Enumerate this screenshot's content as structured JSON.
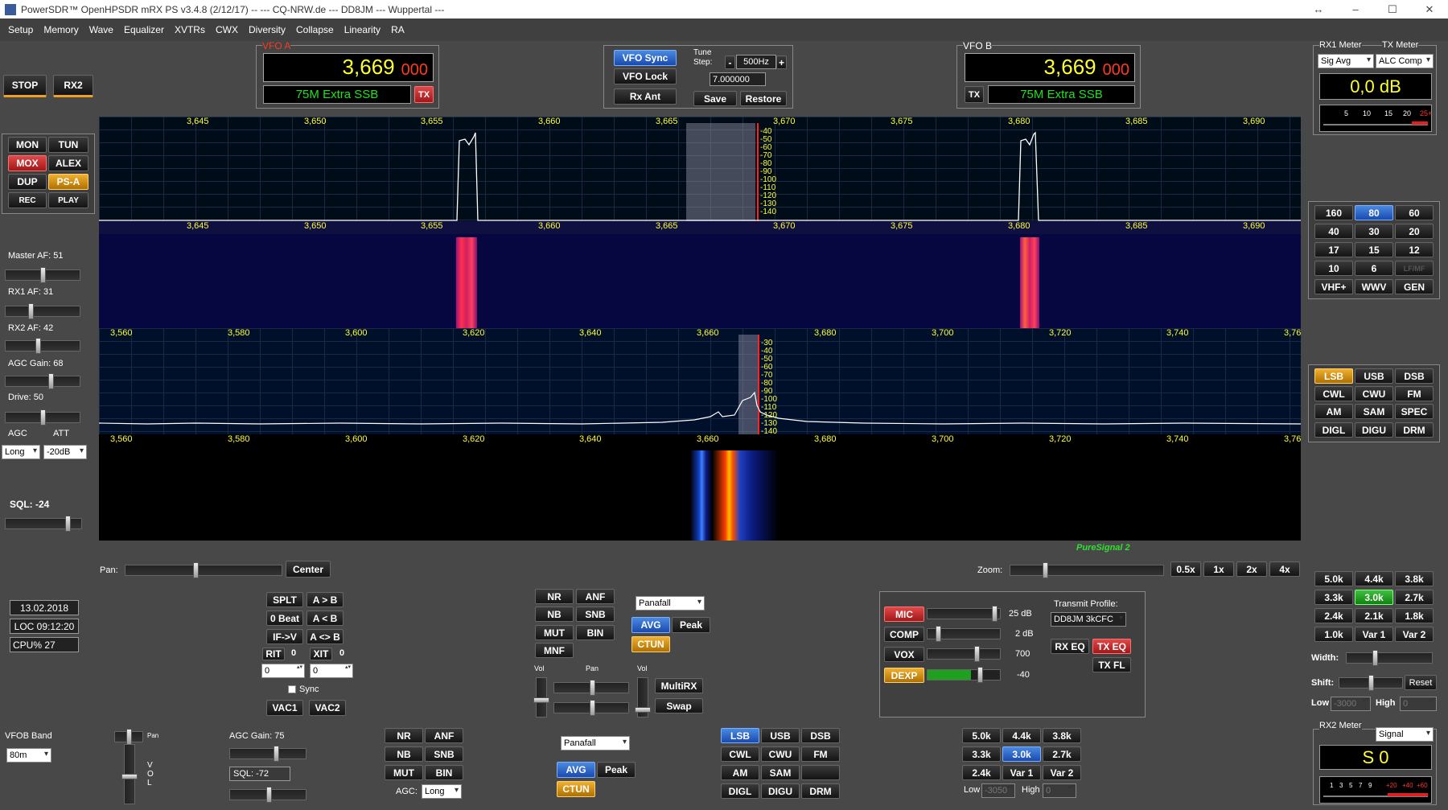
{
  "title": "PowerSDR™ OpenHPSDR mRX PS v3.4.8 (2/12/17)  --  ---  CQ-NRW.de  ---  DD8JM  ---  Wuppertal  ---",
  "menu": [
    "Setup",
    "Memory",
    "Wave",
    "Equalizer",
    "XVTRs",
    "CWX",
    "Diversity",
    "Collapse",
    "Linearity",
    "RA"
  ],
  "left": {
    "stop": "STOP",
    "rx2": "RX2",
    "mon": "MON",
    "tun": "TUN",
    "mox": "MOX",
    "alex": "ALEX",
    "dup": "DUP",
    "psa": "PS-A",
    "rec": "REC",
    "play": "PLAY",
    "master_af": "Master AF:  51",
    "rx1_af": "RX1 AF:  31",
    "rx2_af": "RX2 AF:  42",
    "agc_gain": "AGC Gain:  68",
    "drive": "Drive:  50",
    "agc": "AGC",
    "att": "ATT",
    "agc_val": "Long",
    "att_val": "-20dB",
    "sql": "SQL:  -24"
  },
  "vfoa": {
    "label": "VFO A",
    "mhz": "3,669",
    "hz": "000",
    "band": "75M Extra SSB",
    "tx": "TX"
  },
  "vfob": {
    "label": "VFO B",
    "mhz": "3,669",
    "hz": "000",
    "band": "75M Extra SSB",
    "tx": "TX"
  },
  "center": {
    "vfo_sync": "VFO Sync",
    "vfo_lock": "VFO Lock",
    "rx_ant": "Rx Ant",
    "tune_step": "Tune\nStep:",
    "step": "500Hz",
    "minus": "-",
    "plus": "+",
    "freq": "7.000000",
    "save": "Save",
    "restore": "Restore"
  },
  "meter1": {
    "rx": "RX1 Meter",
    "tx": "TX Meter",
    "mode": "Sig Avg",
    "txmode": "ALC Comp",
    "value": "0,0 dB",
    "scale": [
      "5",
      "10",
      "15",
      "20",
      "25+"
    ]
  },
  "scope1": {
    "ticks": [
      "3,645",
      "3,650",
      "3,655",
      "3,660",
      "3,665",
      "3,670",
      "3,675",
      "3,680",
      "3,685",
      "3,690"
    ],
    "db": [
      "-40",
      "-50",
      "-60",
      "-70",
      "-80",
      "-90",
      "-100",
      "-110",
      "-120",
      "-130",
      "-140"
    ]
  },
  "scope2": {
    "ticks": [
      "3,560",
      "3,580",
      "3,600",
      "3,620",
      "3,640",
      "3,660",
      "3,680",
      "3,700",
      "3,720",
      "3,740",
      "3,76"
    ],
    "db": [
      "-30",
      "-40",
      "-50",
      "-60",
      "-70",
      "-80",
      "-90",
      "-100",
      "-110",
      "-120",
      "-130",
      "-140"
    ]
  },
  "puresignal": "PureSignal 2",
  "bands": [
    "160",
    "80",
    "60",
    "40",
    "30",
    "20",
    "17",
    "15",
    "12",
    "10",
    "6",
    "LF/MF",
    "VHF+",
    "WWV",
    "GEN"
  ],
  "modes": [
    "LSB",
    "USB",
    "DSB",
    "CWL",
    "CWU",
    "FM",
    "AM",
    "SAM",
    "SPEC",
    "DIGL",
    "DIGU",
    "DRM"
  ],
  "filters": [
    "5.0k",
    "4.4k",
    "3.8k",
    "3.3k",
    "3.0k",
    "2.7k",
    "2.4k",
    "2.1k",
    "1.8k",
    "1.0k",
    "Var 1",
    "Var 2"
  ],
  "filterpanel": {
    "width": "Width:",
    "shift": "Shift:",
    "reset": "Reset",
    "low": "Low",
    "low_val": "-3000",
    "high": "High",
    "high_val": "0"
  },
  "meter2": {
    "label": "RX2 Meter",
    "mode": "Signal",
    "value": "S 0",
    "scale": [
      "1",
      "3",
      "5",
      "7",
      "9",
      "+20",
      "+40",
      "+60"
    ]
  },
  "pan": {
    "label": "Pan:",
    "center": "Center",
    "zoom": "Zoom:",
    "z1": "0.5x",
    "z2": "1x",
    "z3": "2x",
    "z4": "4x"
  },
  "status": {
    "date": "13.02.2018",
    "loc": "LOC 09:12:20",
    "cpu": "CPU%  27"
  },
  "vfoctl": {
    "splt": "SPLT",
    "atob": "A > B",
    "zbeat": "0 Beat",
    "altb": "A < B",
    "ifv": "IF->V",
    "aswb": "A <> B",
    "rit": "RIT",
    "rit_v": "0",
    "xit": "XIT",
    "xit_v": "0",
    "rit_spin": "0",
    "xit_spin": "0",
    "sync": "Sync",
    "vac1": "VAC1",
    "vac2": "VAC2"
  },
  "dsp1": {
    "nr": "NR",
    "anf": "ANF",
    "nb": "NB",
    "snb": "SNB",
    "mut": "MUT",
    "bin": "BIN",
    "mnf": "MNF",
    "display": "Panafall",
    "avg": "AVG",
    "peak": "Peak",
    "ctun": "CTUN",
    "vol": "Vol",
    "pan": "Pan",
    "vol2": "Vol",
    "multirx": "MultiRX",
    "swap": "Swap"
  },
  "tx": {
    "mic": "MIC",
    "mic_v": "25 dB",
    "comp": "COMP",
    "comp_v": "2 dB",
    "vox": "VOX",
    "vox_v": "700",
    "dexp": "DEXP",
    "dexp_v": "-40",
    "profile_lbl": "Transmit Profile:",
    "profile": "DD8JM 3kCFC",
    "rxeq": "RX EQ",
    "txeq": "TX EQ",
    "txfl": "TX FL"
  },
  "bottom": {
    "vfob_band": "VFOB Band",
    "band_val": "80m",
    "pan": "Pan",
    "vol": "V\nO\nL",
    "agc_gain": "AGC Gain:  75",
    "sql": "SQL:  -72",
    "nr": "NR",
    "anf": "ANF",
    "nb": "NB",
    "snb": "SNB",
    "mut": "MUT",
    "bin": "BIN",
    "agc": "AGC:",
    "agc_val": "Long",
    "display": "Panafall",
    "avg": "AVG",
    "peak": "Peak",
    "ctun": "CTUN",
    "low": "Low",
    "low_val": "-3050",
    "high": "High",
    "high_val": "0"
  }
}
